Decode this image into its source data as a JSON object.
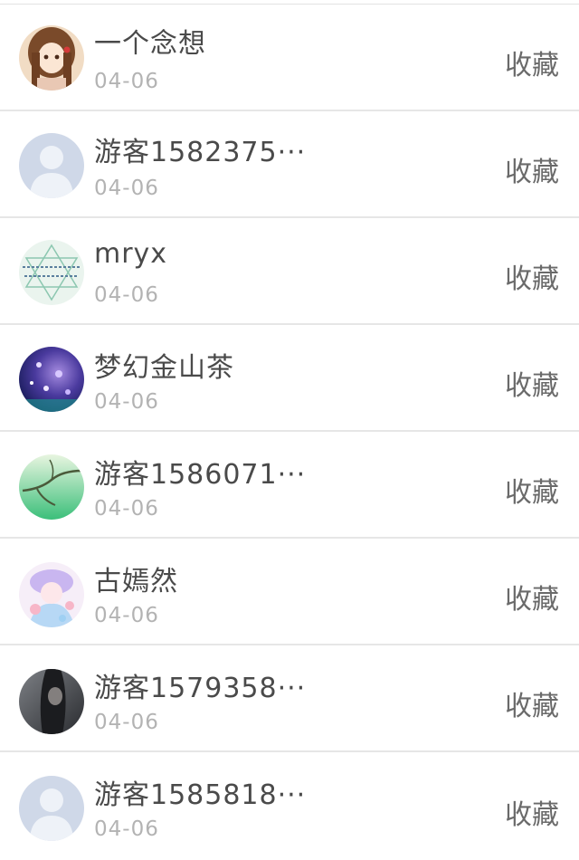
{
  "items": [
    {
      "name": "一个念想",
      "date": "04-06",
      "action": "收藏",
      "avatar": "anime-girl-avatar"
    },
    {
      "name": "游客1582375···",
      "date": "04-06",
      "action": "收藏",
      "avatar": "default-user-avatar"
    },
    {
      "name": "mryx",
      "date": "04-06",
      "action": "收藏",
      "avatar": "geometric-pattern-avatar"
    },
    {
      "name": "梦幻金山茶",
      "date": "04-06",
      "action": "收藏",
      "avatar": "purple-blossom-avatar"
    },
    {
      "name": "游客1586071···",
      "date": "04-06",
      "action": "收藏",
      "avatar": "green-branch-avatar"
    },
    {
      "name": "古嫣然",
      "date": "04-06",
      "action": "收藏",
      "avatar": "pastel-anime-avatar"
    },
    {
      "name": "游客1579358···",
      "date": "04-06",
      "action": "收藏",
      "avatar": "dark-portrait-avatar"
    },
    {
      "name": "游客1585818···",
      "date": "04-06",
      "action": "收藏",
      "avatar": "default-user-avatar"
    }
  ],
  "colors": {
    "name_text": "#4a4a4a",
    "date_text": "#b3b3b3",
    "action_text": "#6a6a6a",
    "divider": "#e6e6e6",
    "default_avatar_bg": "#cfd8e8"
  }
}
